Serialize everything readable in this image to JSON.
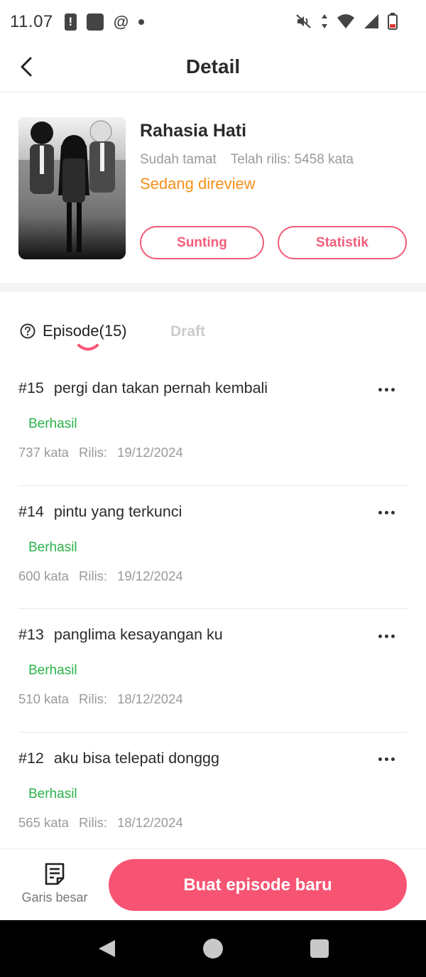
{
  "status_bar": {
    "time": "11.07",
    "alert_glyph": "!",
    "threads_glyph": "@",
    "icons": [
      "alert-icon",
      "app-square-icon",
      "threads-icon",
      "dot-icon",
      "mute-icon",
      "data-arrows-icon",
      "wifi-icon",
      "signal-icon",
      "battery-low-icon"
    ]
  },
  "header": {
    "title": "Detail",
    "back_icon": "chevron-left-icon"
  },
  "book": {
    "title": "Rahasia Hati",
    "status": "Sudah tamat",
    "released_words": "Telah rilis: 5458 kata",
    "review_status": "Sedang direview",
    "edit_label": "Sunting",
    "stats_label": "Statistik"
  },
  "tabs": {
    "episode_label": "Episode(15)",
    "draft_label": "Draft",
    "help_icon": "question-circle-icon"
  },
  "episodes": [
    {
      "number": "#15",
      "title": "pergi dan takan pernah kembali",
      "status": "Berhasil",
      "words": "737 kata",
      "release_label": "Rilis:",
      "date": "19/12/2024"
    },
    {
      "number": "#14",
      "title": "pintu yang terkunci",
      "status": "Berhasil",
      "words": "600 kata",
      "release_label": "Rilis:",
      "date": "19/12/2024"
    },
    {
      "number": "#13",
      "title": "panglima kesayangan ku",
      "status": "Berhasil",
      "words": "510 kata",
      "release_label": "Rilis:",
      "date": "18/12/2024"
    },
    {
      "number": "#12",
      "title": "aku bisa telepati donggg",
      "status": "Berhasil",
      "words": "565 kata",
      "release_label": "Rilis:",
      "date": "18/12/2024"
    }
  ],
  "bottom_bar": {
    "outline_label": "Garis besar",
    "create_label": "Buat episode baru"
  },
  "colors": {
    "accent": "#f75473",
    "review": "#f5901a",
    "success": "#2bb34a",
    "muted": "#9a9a9a"
  }
}
